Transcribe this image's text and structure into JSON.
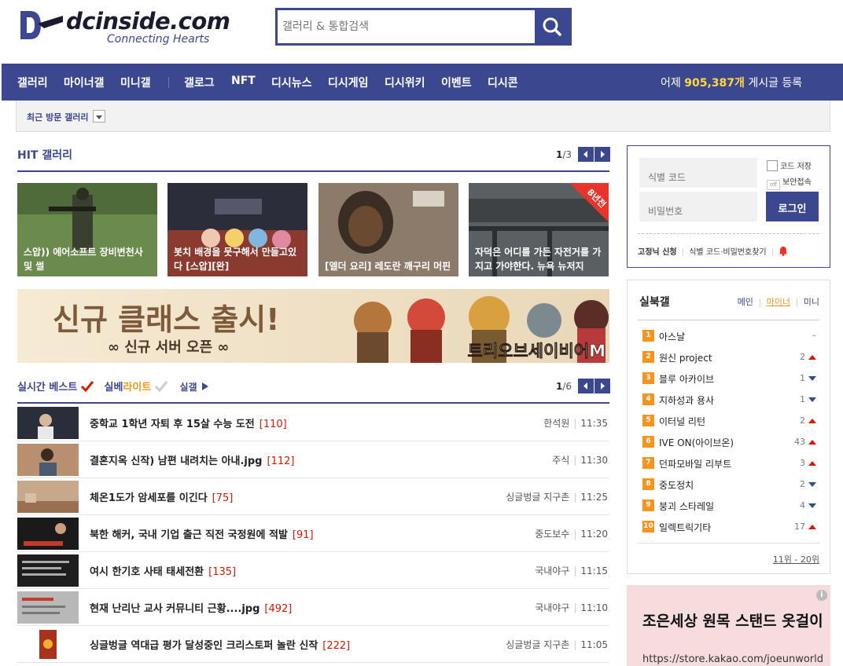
{
  "header": {
    "logo_text": "dcinside.com",
    "tagline": "Connecting Hearts",
    "search_placeholder": "갤러리 & 통합검색"
  },
  "nav": {
    "items": [
      "갤러리",
      "마이너갤",
      "미니갤",
      "갤로그",
      "NFT",
      "디시뉴스",
      "디시게임",
      "디시위키",
      "이벤트",
      "디시콘"
    ],
    "post_prefix": "어제",
    "post_count": "905,387개",
    "post_suffix": "게시글 등록"
  },
  "recent_visit": {
    "label": "최근 방문 갤러리"
  },
  "hit": {
    "title": "HIT 갤러리",
    "page": "1",
    "total": "/3",
    "items": [
      {
        "caption": "스압)) 에어소프트 장비변천사 및 썰"
      },
      {
        "caption": "봇치 배경을 뭇구해서 만들고있다 [스압][완]"
      },
      {
        "caption": "[엘더 요리] 레도란 깨구리 머핀"
      },
      {
        "caption": "자덕은 어디를 가든 자전거를 가지고 가야한다. 뉴욕 뉴저지",
        "badge": "8년전"
      }
    ]
  },
  "banner": {
    "headline": "신규 클래스 출시!",
    "subline": "∞ 신규 서버 오픈 ∞",
    "game_name": "트리오브세이비어M"
  },
  "best": {
    "tab_best": "실시간 베스트",
    "tab_lite_a": "실베",
    "tab_lite_b": "라이트",
    "tab_gall": "실갤",
    "page": "1",
    "total": "/6",
    "rows": [
      {
        "title": "중학교 1학년 자퇴 후 15살 수능 도전",
        "count": "[110]",
        "gallery": "한석원",
        "time": "11:35"
      },
      {
        "title": "결혼지옥 신작) 남편 내려치는 아내.jpg",
        "count": "[112]",
        "gallery": "주식",
        "time": "11:30"
      },
      {
        "title": "체온1도가 암세포를 이긴다",
        "count": "[75]",
        "gallery": "싱글벙글 지구촌",
        "time": "11:25"
      },
      {
        "title": "북한 해커, 국내 기업 출근 직전 국정원에 적발",
        "count": "[91]",
        "gallery": "중도보수",
        "time": "11:20"
      },
      {
        "title": "여시 한기호 사태 태세전환",
        "count": "[135]",
        "gallery": "국내야구",
        "time": "11:15"
      },
      {
        "title": "현재 난리난 교사 커뮤니티 근황....jpg",
        "count": "[492]",
        "gallery": "국내야구",
        "time": "11:10"
      },
      {
        "title": "싱글벙글 역대급 평가 달성중인 크리스토퍼 놀란 신작",
        "count": "[222]",
        "gallery": "싱글벙글 지구촌",
        "time": "11:05"
      }
    ]
  },
  "login": {
    "id_placeholder": "식별 코드",
    "pw_placeholder": "비밀번호",
    "save_code": "코드 저장",
    "off_label": "off",
    "secure_label": "보안접속",
    "login_button": "로그인",
    "fixed_nick": "고정닉 신청",
    "find_link": "식별 코드·비밀번호찾기"
  },
  "ranking": {
    "title": "실북갤",
    "tab_main": "메인",
    "tab_minor": "마이너",
    "tab_mini": "미니",
    "more": "11위 - 20위",
    "items": [
      {
        "rank": "1",
        "name": "아스날",
        "delta": "",
        "dir": "none"
      },
      {
        "rank": "2",
        "name": "원신 project",
        "delta": "2",
        "dir": "up"
      },
      {
        "rank": "3",
        "name": "블루 아카이브",
        "delta": "1",
        "dir": "down"
      },
      {
        "rank": "4",
        "name": "지하성과 용사",
        "delta": "1",
        "dir": "down"
      },
      {
        "rank": "5",
        "name": "이터널 리턴",
        "delta": "2",
        "dir": "up"
      },
      {
        "rank": "6",
        "name": "IVE ON(아이브온)",
        "delta": "43",
        "dir": "up"
      },
      {
        "rank": "7",
        "name": "던파모바일 리부트",
        "delta": "3",
        "dir": "up"
      },
      {
        "rank": "8",
        "name": "중도정치",
        "delta": "2",
        "dir": "down"
      },
      {
        "rank": "9",
        "name": "붕괴 스타레일",
        "delta": "4",
        "dir": "down"
      },
      {
        "rank": "10",
        "name": "일렉트릭기타",
        "delta": "17",
        "dir": "up"
      }
    ]
  },
  "ad": {
    "title": "조은세상 원목 스탠드 옷걸이",
    "url": "https://store.kakao.com/joeunworld",
    "info": "i"
  },
  "colors": {
    "brand": "#3b4890",
    "accent": "#ffd83f",
    "count": "#d31900",
    "rank_badge": "#f7941d"
  }
}
